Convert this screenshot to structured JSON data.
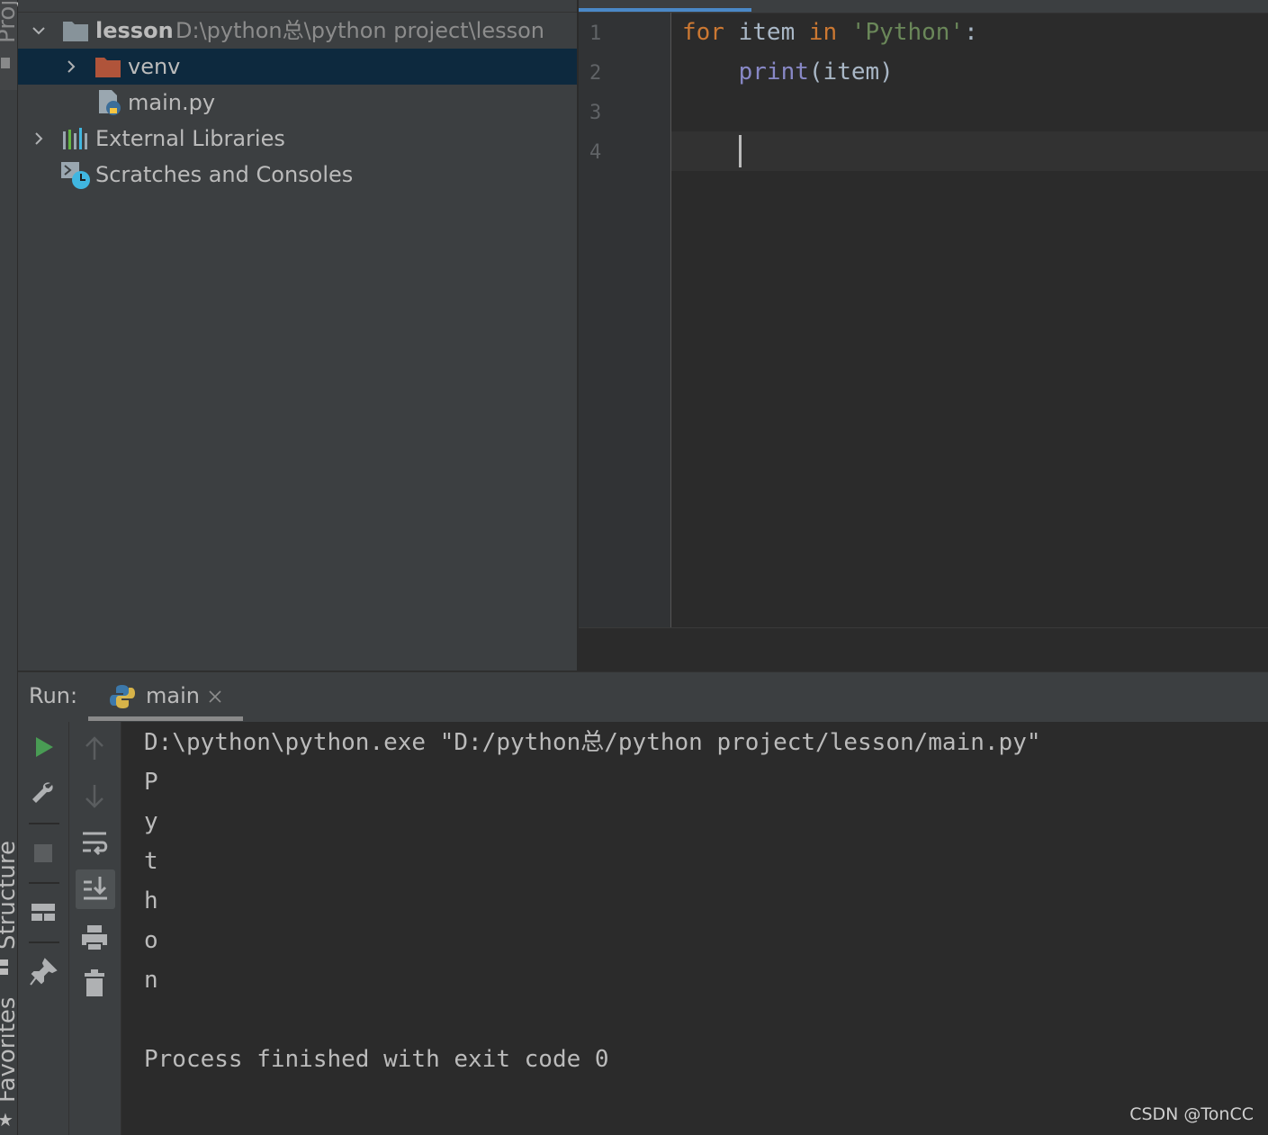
{
  "side_strip": {
    "project_label": "Proje",
    "structure_label": "Structure",
    "favorites_label": "Favorites"
  },
  "project_tree": {
    "root": {
      "name": "lesson",
      "path": "D:\\python总\\python project\\lesson"
    },
    "items": [
      {
        "label": "venv",
        "icon": "folder-icon",
        "expanded": false,
        "selected": true
      },
      {
        "label": "main.py",
        "icon": "python-file-icon"
      },
      {
        "label": "External Libraries",
        "icon": "library-icon",
        "expanded": false
      },
      {
        "label": "Scratches and Consoles",
        "icon": "scratches-icon"
      }
    ]
  },
  "editor": {
    "line_numbers": [
      "1",
      "2",
      "3",
      "4"
    ],
    "code": {
      "l1_kw1": "for",
      "l1_var": " item ",
      "l1_kw2": "in",
      "l1_str": " 'Python'",
      "l1_colon": ":",
      "l2_indent": "    ",
      "l2_fn": "print",
      "l2_rest": "(item)"
    }
  },
  "run_panel": {
    "label": "Run:",
    "tab": "main",
    "console_lines": [
      "D:\\python\\python.exe \"D:/python总/python project/lesson/main.py\"",
      "P",
      "y",
      "t",
      "h",
      "o",
      "n",
      "",
      "Process finished with exit code 0"
    ]
  },
  "watermark": "CSDN @TonCC",
  "colors": {
    "keyword": "#cc7832",
    "string": "#6a8759",
    "builtin": "#8888c6",
    "selection": "#0d293e",
    "accent": "#4a88c7",
    "run": "#499c54"
  }
}
